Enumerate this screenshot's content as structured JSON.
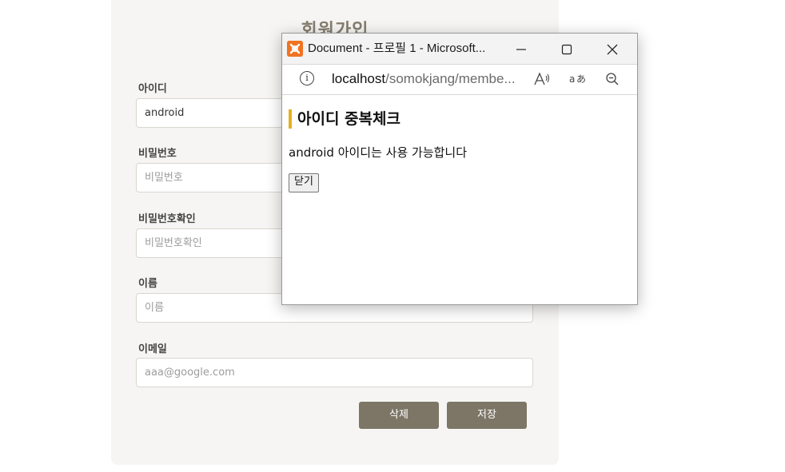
{
  "form": {
    "title": "회원가입",
    "fields": [
      {
        "label": "아이디",
        "value": "android",
        "placeholder": ""
      },
      {
        "label": "비밀번호",
        "value": "",
        "placeholder": "비밀번호"
      },
      {
        "label": "비밀번호확인",
        "value": "",
        "placeholder": "비밀번호확인"
      },
      {
        "label": "이름",
        "value": "",
        "placeholder": "이름"
      },
      {
        "label": "이메일",
        "value": "",
        "placeholder": "aaa@google.com"
      }
    ],
    "delete_label": "삭제",
    "save_label": "저장",
    "colors": {
      "button": "#7d7667",
      "card": "#f6f5f3",
      "title": "#857d70"
    }
  },
  "popup": {
    "window_title": "Document - 프로필 1 - Microsoft...",
    "minimize_icon": "minimize-icon",
    "maximize_icon": "maximize-icon",
    "close_icon": "close-icon",
    "url_host": "localhost",
    "url_path": "/somokjang/membe...",
    "heading": "아이디 중복체크",
    "message": "android 아이디는 사용 가능합니다",
    "close_button": "닫기",
    "colors": {
      "heading_accent": "#e6b01e",
      "app_icon": "#f07322"
    }
  }
}
